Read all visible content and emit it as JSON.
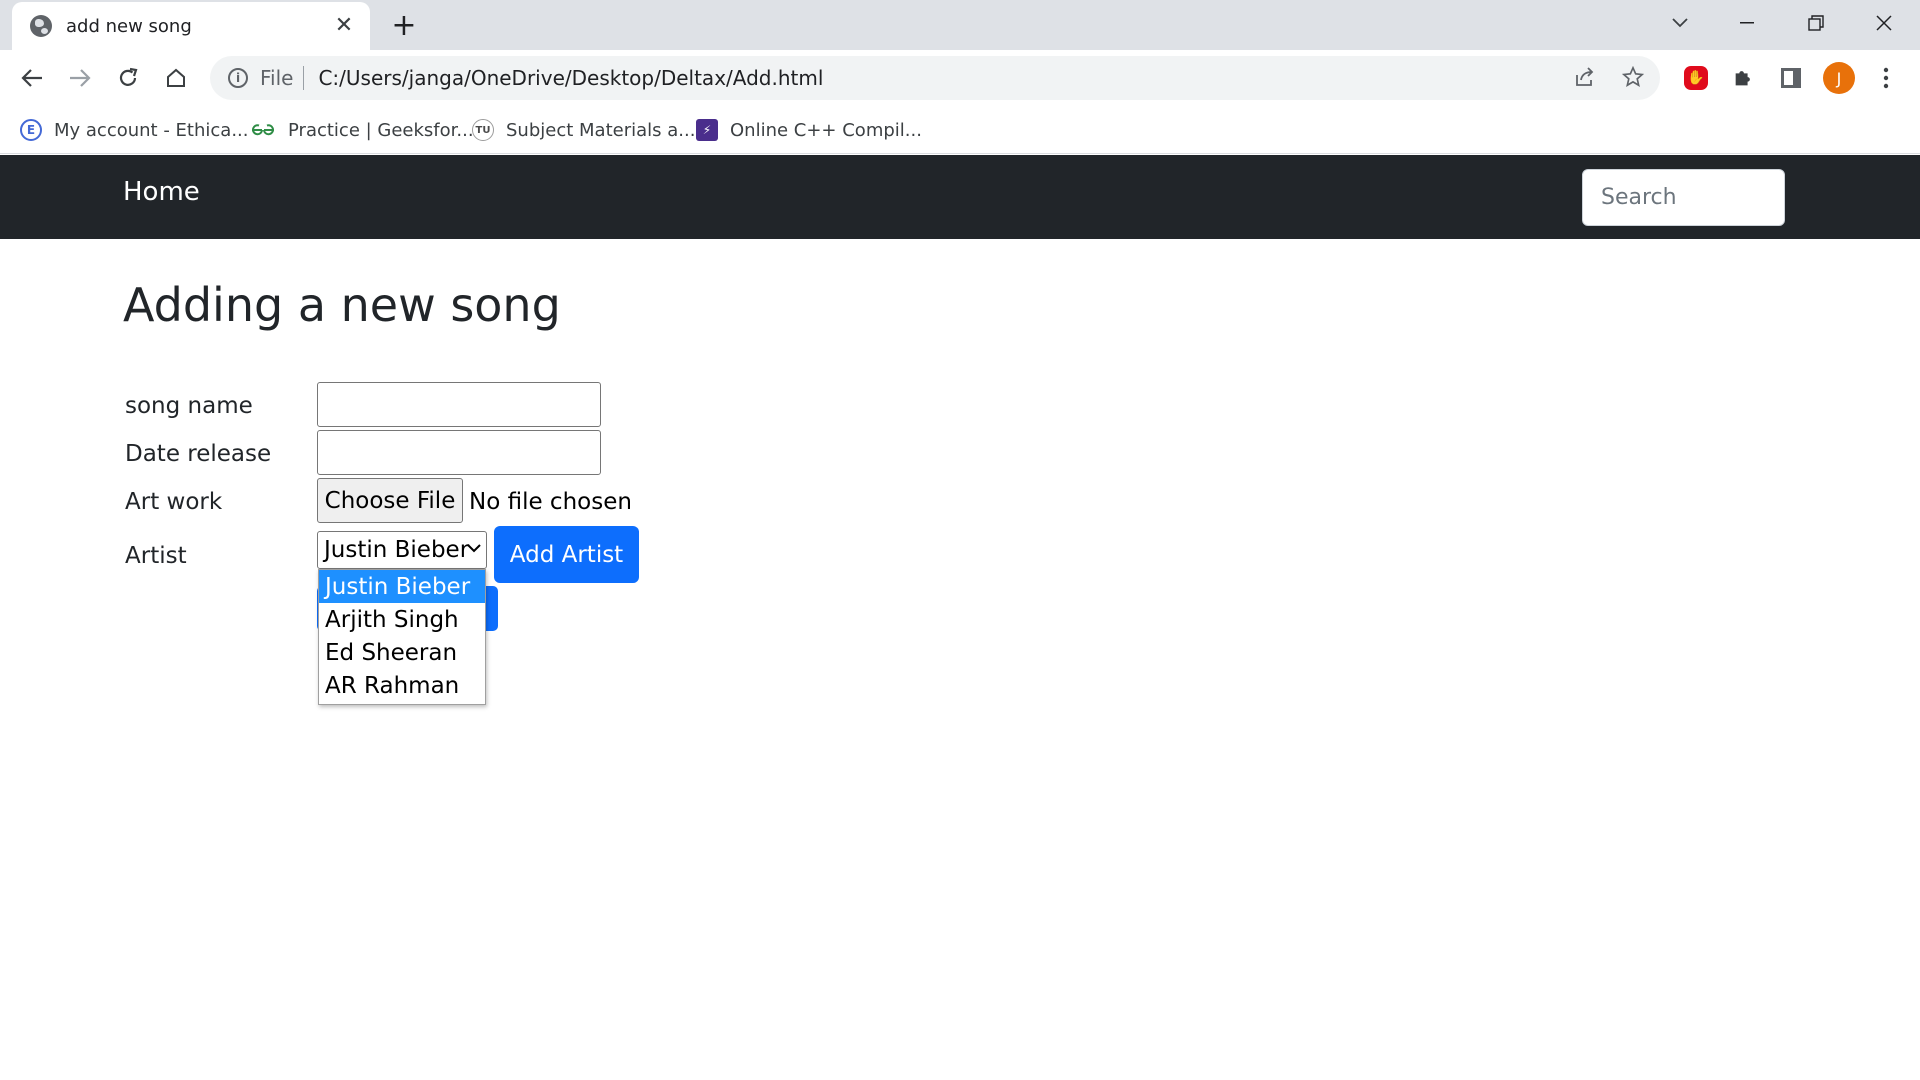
{
  "browser": {
    "tab_title": "add new song",
    "tab_close": "✕",
    "new_tab": "+",
    "scheme": "File",
    "url": "C:/Users/janga/OneDrive/Desktop/Deltax/Add.html",
    "profile_initial": "J",
    "bookmarks": [
      {
        "label": "My account - Ethica...",
        "icon": "E"
      },
      {
        "label": "Practice | Geeksfor...",
        "icon": "GfG"
      },
      {
        "label": "Subject Materials a...",
        "icon": "TU"
      },
      {
        "label": "Online C++ Compil...",
        "icon": "⚡"
      }
    ]
  },
  "navbar": {
    "brand": "Home",
    "search_placeholder": "Search"
  },
  "page": {
    "heading": "Adding a new song",
    "song_name_label": "song name",
    "date_release_label": "Date release",
    "art_work_label": "Art work",
    "artist_label": "Artist",
    "choose_file": "Choose File",
    "file_status": "No file chosen",
    "artist_selected": "Justin Bieber",
    "add_artist": "Add Artist",
    "artist_options": [
      "Justin Bieber",
      "Arjith Singh",
      "Ed Sheeran",
      "AR Rahman"
    ]
  },
  "colors": {
    "navbar_bg": "#212529",
    "primary": "#0d6efd",
    "dropdown_highlight": "#1e90ff",
    "avatar": "#e8710a"
  }
}
